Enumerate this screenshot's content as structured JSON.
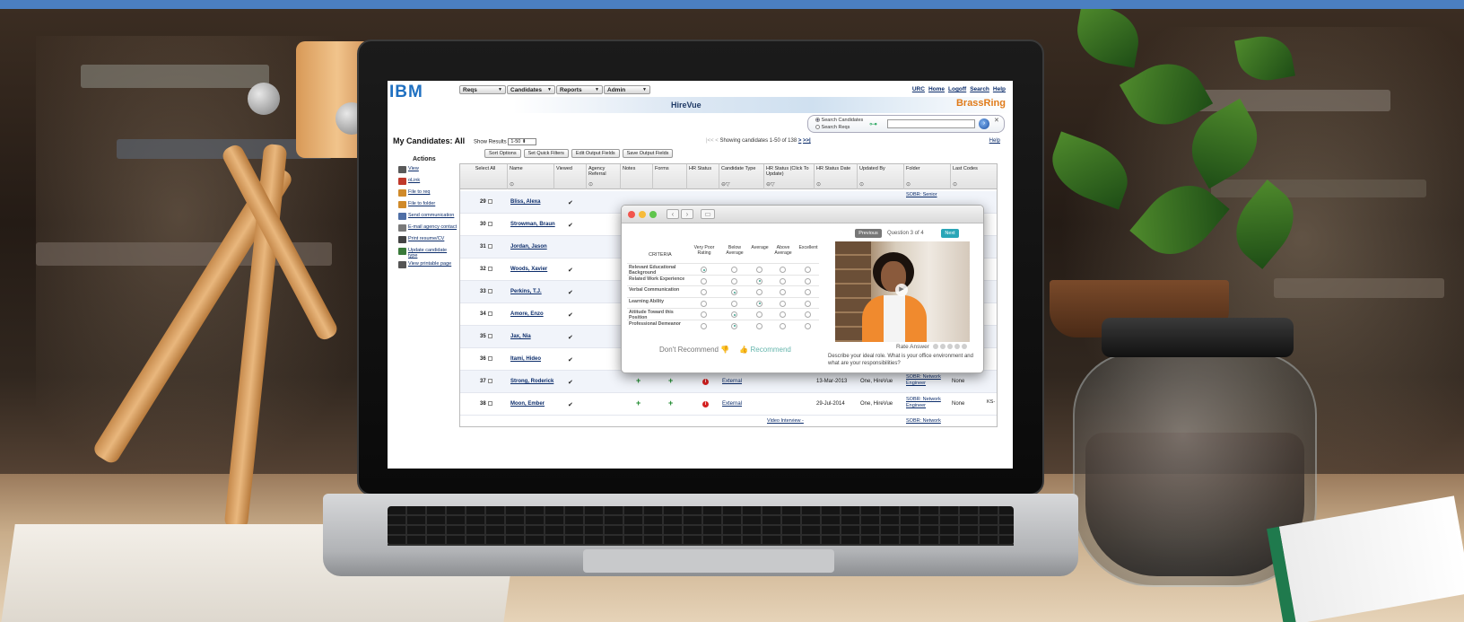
{
  "ibm": "IBM",
  "menu": [
    "Reqs",
    "Candidates",
    "Reports",
    "Admin"
  ],
  "toplinks": [
    "URC",
    "Home",
    "Logoff",
    "Search",
    "Help"
  ],
  "app_title": "HireVue",
  "brand": "BrassRing",
  "search": {
    "opt1": "Search Candidates",
    "opt2": "Search Reqs"
  },
  "page_title": "My Candidates: All",
  "show_results_label": "Show Results",
  "show_results_value": "1-50",
  "pager": {
    "first": "|<<",
    "prev": "<",
    "text": "Showing candidates 1-50 of 138",
    "next": ">",
    "last": ">>|"
  },
  "help": "Help",
  "buttons": [
    "Sort Options",
    "Set Quick Filters",
    "Edit Output Fields",
    "Save Output Fields"
  ],
  "actions_title": "Actions",
  "actions": [
    {
      "label": "View",
      "color": "#5a5a5a"
    },
    {
      "label": "oLink",
      "color": "#c0392b"
    },
    {
      "label": "File to req",
      "color": "#d08a2a"
    },
    {
      "label": "File to folder",
      "color": "#d08a2a"
    },
    {
      "label": "Send communication",
      "color": "#4f6fa6"
    },
    {
      "label": "E-mail agency contact",
      "color": "#7a7a7a"
    },
    {
      "label": "Print resume/CV",
      "color": "#444444"
    },
    {
      "label": "Update candidate type",
      "color": "#3a7a3a"
    },
    {
      "label": "View printable page",
      "color": "#555555"
    }
  ],
  "columns": [
    "Select All",
    "Name",
    "Viewed",
    "Agency Referral",
    "Notes",
    "Forms",
    "HR Status",
    "Candidate Type",
    "HR Status (Click To Update)",
    "HR Status Date",
    "Updated By",
    "Folder",
    "Last Codes"
  ],
  "rows": [
    {
      "num": "29",
      "name": "Bliss, Alexa",
      "viewed": "✔"
    },
    {
      "num": "30",
      "name": "Strowman, Braun",
      "viewed": "✔"
    },
    {
      "num": "31",
      "name": "Jordan, Jason",
      "viewed": ""
    },
    {
      "num": "32",
      "name": "Woods, Xavier",
      "viewed": "✔"
    },
    {
      "num": "33",
      "name": "Perkins, T.J.",
      "viewed": "✔"
    },
    {
      "num": "34",
      "name": "Amore, Enzo",
      "viewed": "✔"
    },
    {
      "num": "35",
      "name": "Jax, Nia",
      "viewed": "✔"
    },
    {
      "num": "36",
      "name": "Itami, Hideo",
      "viewed": "✔"
    },
    {
      "num": "37",
      "name": "Strong, Roderick",
      "viewed": "✔",
      "type": "External",
      "date": "13-Mar-2013",
      "by": "One, HireVue",
      "folder": "SOBR: Network Engineer",
      "codes": "None"
    },
    {
      "num": "38",
      "name": "Moon, Ember",
      "viewed": "✔",
      "type": "External",
      "date": "29-Jul-2014",
      "by": "One, HireVue",
      "folder": "SOBR: Network Engineer",
      "codes": "None"
    }
  ],
  "row29_folder": "SOBR: Senior",
  "row39_status": "Video Interview -",
  "row39_folder": "SOBR: Network",
  "edge_text": "KS-",
  "modal": {
    "criteria_header": "CRITERIA",
    "rating_headers": [
      "Very Poor Rating",
      "Below Average",
      "Average",
      "Above Average",
      "Excellent"
    ],
    "criteria": [
      {
        "label": "Relevant Educational Background",
        "selected": 0
      },
      {
        "label": "Related Work Experience",
        "selected": 2
      },
      {
        "label": "Verbal Communication",
        "selected": 1
      },
      {
        "label": "Learning Ability",
        "selected": 2
      },
      {
        "label": "Attitude Toward this Position",
        "selected": 1
      },
      {
        "label": "Professional Demeanor",
        "selected": 1
      }
    ],
    "dont_recommend": "Don't Recommend",
    "recommend": "Recommend",
    "previous": "Previous",
    "question": "Question 3 of 4",
    "next": "Next",
    "rate_answer": "Rate Answer",
    "question_text": "Describe your ideal role. What is your office environment and what are your responsibilities?"
  }
}
